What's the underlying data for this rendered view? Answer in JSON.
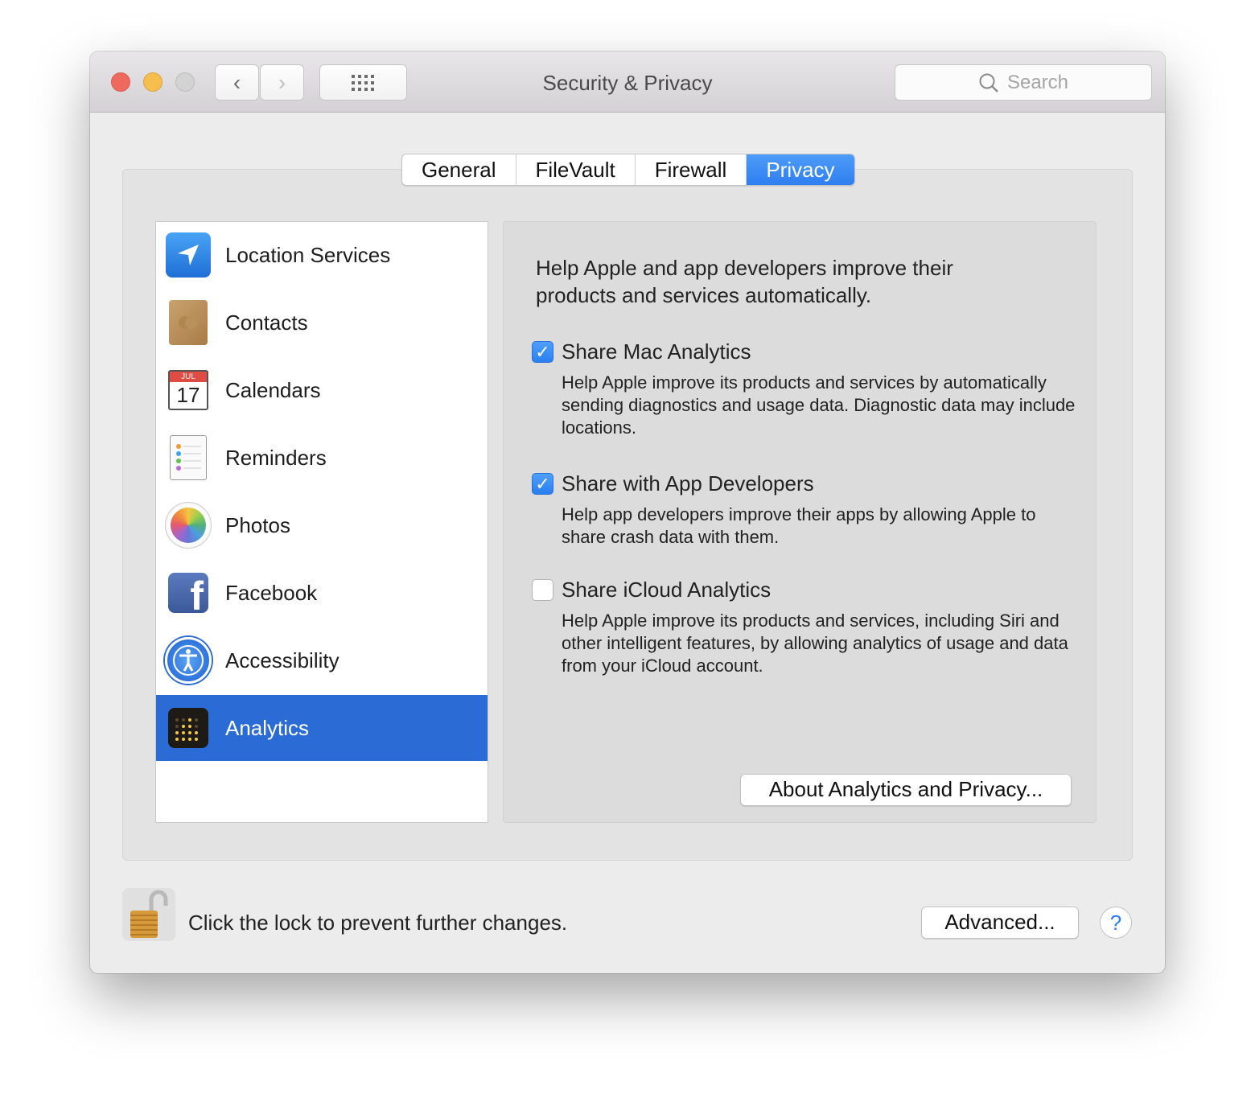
{
  "window": {
    "title": "Security & Privacy",
    "search_placeholder": "Search"
  },
  "colors": {
    "accent": "#2b6bd5",
    "close": "#ee6a5e",
    "minimize": "#f6be4f",
    "zoom": "#d0d0d0"
  },
  "tabs": [
    {
      "label": "General"
    },
    {
      "label": "FileVault"
    },
    {
      "label": "Firewall"
    },
    {
      "label": "Privacy",
      "active": true
    }
  ],
  "sidebar": {
    "items": [
      {
        "label": "Location Services",
        "icon": "location-arrow-icon"
      },
      {
        "label": "Contacts",
        "icon": "contacts-book-icon"
      },
      {
        "label": "Calendars",
        "icon": "calendar-icon",
        "month": "JUL",
        "day": "17"
      },
      {
        "label": "Reminders",
        "icon": "reminders-list-icon"
      },
      {
        "label": "Photos",
        "icon": "photos-flower-icon"
      },
      {
        "label": "Facebook",
        "icon": "facebook-icon"
      },
      {
        "label": "Accessibility",
        "icon": "accessibility-icon"
      },
      {
        "label": "Analytics",
        "icon": "analytics-icon",
        "selected": true
      }
    ]
  },
  "panel": {
    "intro": "Help Apple and app developers improve their products and services automatically.",
    "options": [
      {
        "label": "Share Mac Analytics",
        "checked": true,
        "description": "Help Apple improve its products and services by automatically sending diagnostics and usage data. Diagnostic data may include locations."
      },
      {
        "label": "Share with App Developers",
        "checked": true,
        "description": "Help app developers improve their apps by allowing Apple to share crash data with them."
      },
      {
        "label": "Share iCloud Analytics",
        "checked": false,
        "description": "Help Apple improve its products and services, including Siri and other intelligent features, by allowing analytics of usage and data from your iCloud account."
      }
    ],
    "about_button": "About Analytics and Privacy..."
  },
  "footer": {
    "lock_text": "Click the lock to prevent further changes.",
    "advanced_button": "Advanced...",
    "help_button": "?"
  }
}
